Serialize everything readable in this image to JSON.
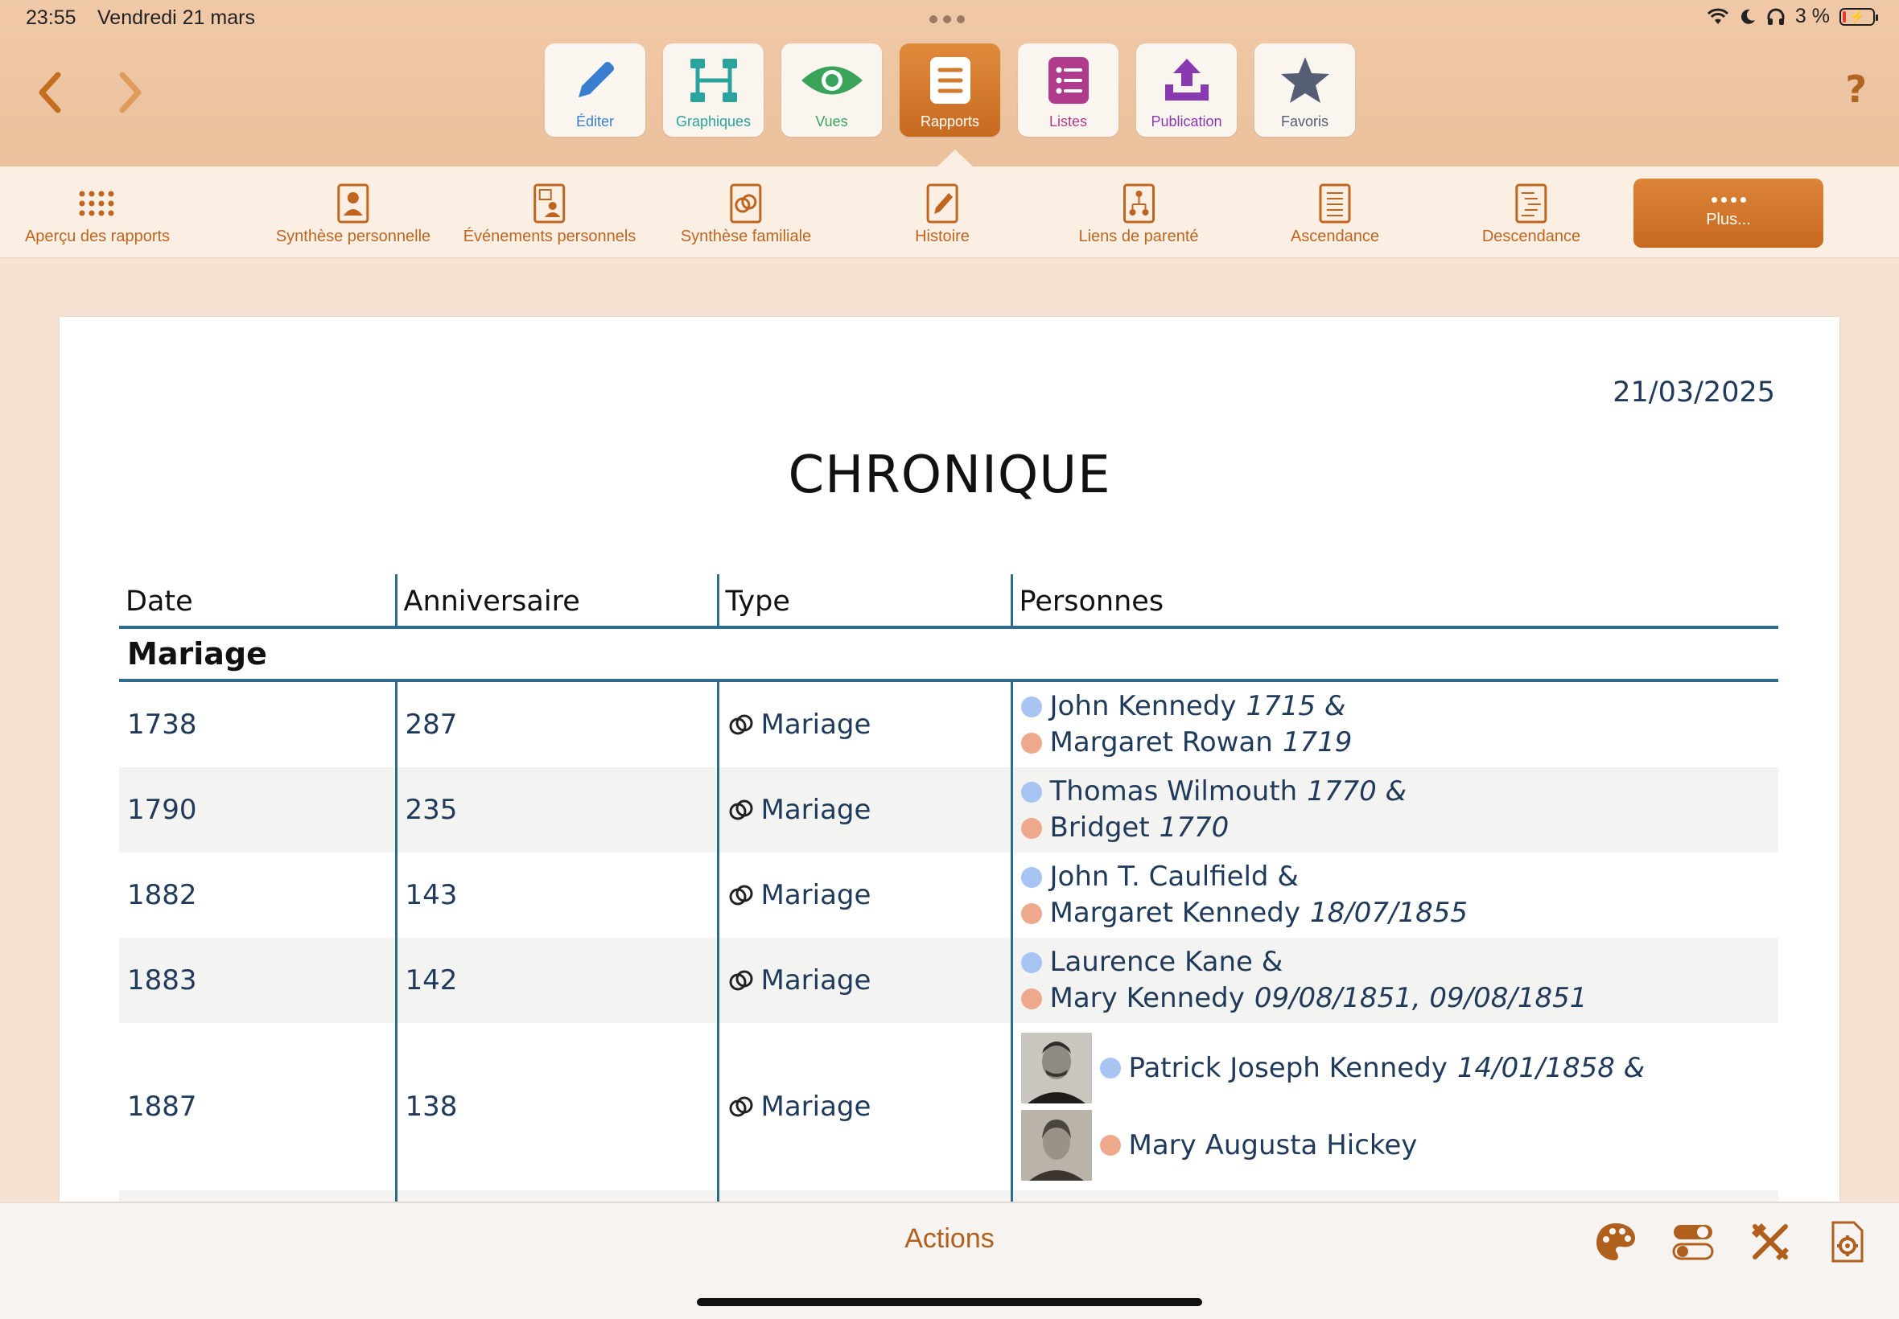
{
  "status_bar": {
    "time": "23:55",
    "date": "Vendredi 21 mars",
    "battery_text": "3 %"
  },
  "main_tabs": [
    {
      "label": "Éditer",
      "icon": "pencil-icon",
      "color": "#3a7fcf"
    },
    {
      "label": "Graphiques",
      "icon": "chart-tree-icon",
      "color": "#2aa39c"
    },
    {
      "label": "Vues",
      "icon": "eye-icon",
      "color": "#3aa35a"
    },
    {
      "label": "Rapports",
      "icon": "report-list-icon",
      "color": "#ffffff"
    },
    {
      "label": "Listes",
      "icon": "list-icon",
      "color": "#b03a8c"
    },
    {
      "label": "Publication",
      "icon": "upload-icon",
      "color": "#8a3ab0"
    },
    {
      "label": "Favoris",
      "icon": "star-icon",
      "color": "#555e74"
    }
  ],
  "report_types": [
    {
      "label": "Aperçu des rapports",
      "icon": "grid-dots-icon"
    },
    {
      "label": "Synthèse personnelle",
      "icon": "person-document-icon"
    },
    {
      "label": "Événements personnels",
      "icon": "calendar-person-icon"
    },
    {
      "label": "Synthèse familiale",
      "icon": "rings-document-icon"
    },
    {
      "label": "Histoire",
      "icon": "pen-document-icon"
    },
    {
      "label": "Liens de parenté",
      "icon": "relationship-document-icon"
    },
    {
      "label": "Ascendance",
      "icon": "ancestry-document-icon"
    },
    {
      "label": "Descendance",
      "icon": "descendancy-document-icon"
    },
    {
      "label": "Plus..."
    }
  ],
  "report": {
    "date": "21/03/2025",
    "title": "CHRONIQUE",
    "columns": [
      "Date",
      "Anniversaire",
      "Type",
      "Personnes"
    ],
    "group_label": "Mariage",
    "rows": [
      {
        "date": "1738",
        "anniversary": "287",
        "type": "Mariage",
        "persons": [
          {
            "name": "John Kennedy",
            "extra": "1715 &",
            "sex": "male"
          },
          {
            "name": "Margaret Rowan",
            "extra": "1719",
            "sex": "female"
          }
        ]
      },
      {
        "date": "1790",
        "anniversary": "235",
        "type": "Mariage",
        "persons": [
          {
            "name": "Thomas Wilmouth",
            "extra": "1770 &",
            "sex": "male"
          },
          {
            "name": "Bridget",
            "extra": "1770",
            "sex": "female"
          }
        ]
      },
      {
        "date": "1882",
        "anniversary": "143",
        "type": "Mariage",
        "persons": [
          {
            "name": "John T. Caulfield &",
            "extra": "",
            "sex": "male"
          },
          {
            "name": "Margaret Kennedy",
            "extra": "18/07/1855",
            "sex": "female"
          }
        ]
      },
      {
        "date": "1883",
        "anniversary": "142",
        "type": "Mariage",
        "persons": [
          {
            "name": "Laurence Kane &",
            "extra": "",
            "sex": "male"
          },
          {
            "name": "Mary Kennedy",
            "extra": "09/08/1851, 09/08/1851",
            "sex": "female"
          }
        ]
      },
      {
        "date": "1887",
        "anniversary": "138",
        "type": "Mariage",
        "persons": [
          {
            "name": "Patrick Joseph Kennedy",
            "extra": "14/01/1858 &",
            "sex": "male"
          },
          {
            "name": "Mary Augusta Hickey",
            "extra": "",
            "sex": "female"
          }
        ]
      }
    ]
  },
  "bottom_bar": {
    "actions_label": "Actions",
    "tools": [
      "palette-icon",
      "toggles-icon",
      "tools-icon",
      "document-settings-icon"
    ]
  }
}
